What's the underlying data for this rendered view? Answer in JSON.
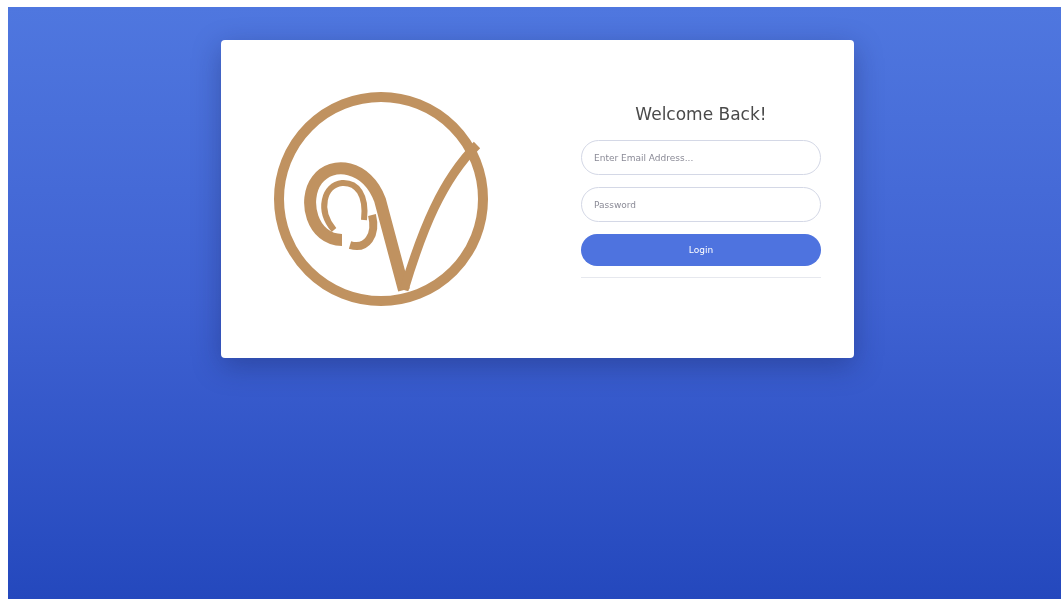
{
  "heading": "Welcome Back!",
  "email": {
    "placeholder": "Enter Email Address..."
  },
  "password": {
    "placeholder": "Password"
  },
  "login_button": "Login"
}
